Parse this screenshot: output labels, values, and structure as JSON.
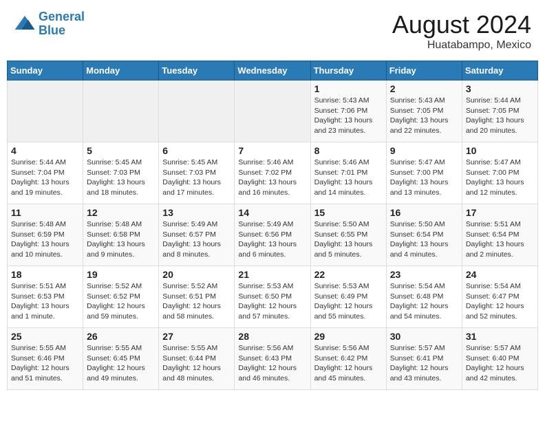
{
  "header": {
    "logo_line1": "General",
    "logo_line2": "Blue",
    "main_title": "August 2024",
    "subtitle": "Huatabampo, Mexico"
  },
  "weekdays": [
    "Sunday",
    "Monday",
    "Tuesday",
    "Wednesday",
    "Thursday",
    "Friday",
    "Saturday"
  ],
  "weeks": [
    [
      {
        "day": "",
        "info": ""
      },
      {
        "day": "",
        "info": ""
      },
      {
        "day": "",
        "info": ""
      },
      {
        "day": "",
        "info": ""
      },
      {
        "day": "1",
        "info": "Sunrise: 5:43 AM\nSunset: 7:06 PM\nDaylight: 13 hours\nand 23 minutes."
      },
      {
        "day": "2",
        "info": "Sunrise: 5:43 AM\nSunset: 7:05 PM\nDaylight: 13 hours\nand 22 minutes."
      },
      {
        "day": "3",
        "info": "Sunrise: 5:44 AM\nSunset: 7:05 PM\nDaylight: 13 hours\nand 20 minutes."
      }
    ],
    [
      {
        "day": "4",
        "info": "Sunrise: 5:44 AM\nSunset: 7:04 PM\nDaylight: 13 hours\nand 19 minutes."
      },
      {
        "day": "5",
        "info": "Sunrise: 5:45 AM\nSunset: 7:03 PM\nDaylight: 13 hours\nand 18 minutes."
      },
      {
        "day": "6",
        "info": "Sunrise: 5:45 AM\nSunset: 7:03 PM\nDaylight: 13 hours\nand 17 minutes."
      },
      {
        "day": "7",
        "info": "Sunrise: 5:46 AM\nSunset: 7:02 PM\nDaylight: 13 hours\nand 16 minutes."
      },
      {
        "day": "8",
        "info": "Sunrise: 5:46 AM\nSunset: 7:01 PM\nDaylight: 13 hours\nand 14 minutes."
      },
      {
        "day": "9",
        "info": "Sunrise: 5:47 AM\nSunset: 7:00 PM\nDaylight: 13 hours\nand 13 minutes."
      },
      {
        "day": "10",
        "info": "Sunrise: 5:47 AM\nSunset: 7:00 PM\nDaylight: 13 hours\nand 12 minutes."
      }
    ],
    [
      {
        "day": "11",
        "info": "Sunrise: 5:48 AM\nSunset: 6:59 PM\nDaylight: 13 hours\nand 10 minutes."
      },
      {
        "day": "12",
        "info": "Sunrise: 5:48 AM\nSunset: 6:58 PM\nDaylight: 13 hours\nand 9 minutes."
      },
      {
        "day": "13",
        "info": "Sunrise: 5:49 AM\nSunset: 6:57 PM\nDaylight: 13 hours\nand 8 minutes."
      },
      {
        "day": "14",
        "info": "Sunrise: 5:49 AM\nSunset: 6:56 PM\nDaylight: 13 hours\nand 6 minutes."
      },
      {
        "day": "15",
        "info": "Sunrise: 5:50 AM\nSunset: 6:55 PM\nDaylight: 13 hours\nand 5 minutes."
      },
      {
        "day": "16",
        "info": "Sunrise: 5:50 AM\nSunset: 6:54 PM\nDaylight: 13 hours\nand 4 minutes."
      },
      {
        "day": "17",
        "info": "Sunrise: 5:51 AM\nSunset: 6:54 PM\nDaylight: 13 hours\nand 2 minutes."
      }
    ],
    [
      {
        "day": "18",
        "info": "Sunrise: 5:51 AM\nSunset: 6:53 PM\nDaylight: 13 hours\nand 1 minute."
      },
      {
        "day": "19",
        "info": "Sunrise: 5:52 AM\nSunset: 6:52 PM\nDaylight: 12 hours\nand 59 minutes."
      },
      {
        "day": "20",
        "info": "Sunrise: 5:52 AM\nSunset: 6:51 PM\nDaylight: 12 hours\nand 58 minutes."
      },
      {
        "day": "21",
        "info": "Sunrise: 5:53 AM\nSunset: 6:50 PM\nDaylight: 12 hours\nand 57 minutes."
      },
      {
        "day": "22",
        "info": "Sunrise: 5:53 AM\nSunset: 6:49 PM\nDaylight: 12 hours\nand 55 minutes."
      },
      {
        "day": "23",
        "info": "Sunrise: 5:54 AM\nSunset: 6:48 PM\nDaylight: 12 hours\nand 54 minutes."
      },
      {
        "day": "24",
        "info": "Sunrise: 5:54 AM\nSunset: 6:47 PM\nDaylight: 12 hours\nand 52 minutes."
      }
    ],
    [
      {
        "day": "25",
        "info": "Sunrise: 5:55 AM\nSunset: 6:46 PM\nDaylight: 12 hours\nand 51 minutes."
      },
      {
        "day": "26",
        "info": "Sunrise: 5:55 AM\nSunset: 6:45 PM\nDaylight: 12 hours\nand 49 minutes."
      },
      {
        "day": "27",
        "info": "Sunrise: 5:55 AM\nSunset: 6:44 PM\nDaylight: 12 hours\nand 48 minutes."
      },
      {
        "day": "28",
        "info": "Sunrise: 5:56 AM\nSunset: 6:43 PM\nDaylight: 12 hours\nand 46 minutes."
      },
      {
        "day": "29",
        "info": "Sunrise: 5:56 AM\nSunset: 6:42 PM\nDaylight: 12 hours\nand 45 minutes."
      },
      {
        "day": "30",
        "info": "Sunrise: 5:57 AM\nSunset: 6:41 PM\nDaylight: 12 hours\nand 43 minutes."
      },
      {
        "day": "31",
        "info": "Sunrise: 5:57 AM\nSunset: 6:40 PM\nDaylight: 12 hours\nand 42 minutes."
      }
    ]
  ]
}
